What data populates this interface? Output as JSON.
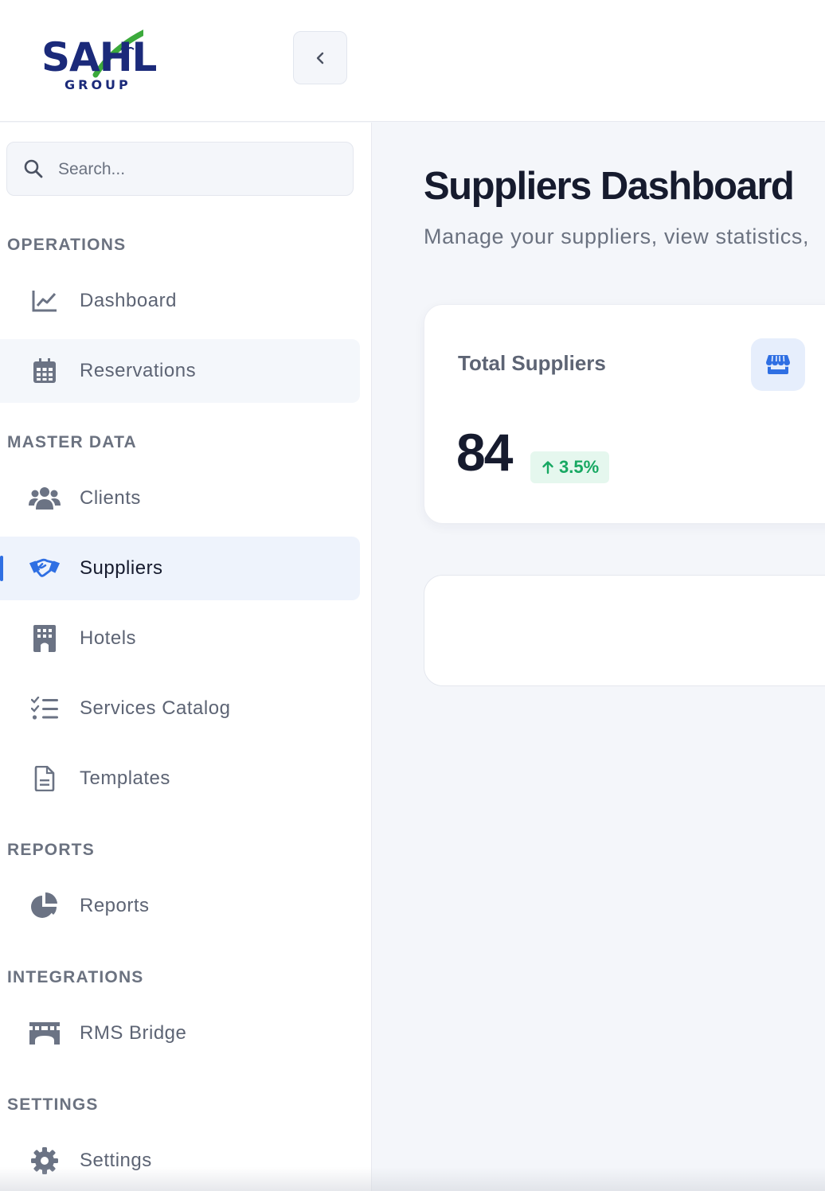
{
  "brand": {
    "logo_main": "SAHL",
    "logo_sub": "GROUP",
    "logo_navy": "#1b2a7a",
    "logo_green": "#3caa3c"
  },
  "header": {
    "collapse_icon": "chevron-left-icon"
  },
  "search": {
    "placeholder": "Search..."
  },
  "sidebar": {
    "sections": [
      {
        "label": "OPERATIONS"
      },
      {
        "label": "MASTER DATA"
      },
      {
        "label": "REPORTS"
      },
      {
        "label": "INTEGRATIONS"
      },
      {
        "label": "SETTINGS"
      }
    ],
    "items": [
      {
        "label": "Dashboard",
        "icon": "chart-line-icon"
      },
      {
        "label": "Reservations",
        "icon": "calendar-icon"
      },
      {
        "label": "Clients",
        "icon": "users-icon"
      },
      {
        "label": "Suppliers",
        "icon": "handshake-icon",
        "active": true
      },
      {
        "label": "Hotels",
        "icon": "building-icon"
      },
      {
        "label": "Services Catalog",
        "icon": "list-check-icon"
      },
      {
        "label": "Templates",
        "icon": "document-icon"
      },
      {
        "label": "Reports",
        "icon": "pie-chart-icon"
      },
      {
        "label": "RMS Bridge",
        "icon": "bridge-icon"
      },
      {
        "label": "Settings",
        "icon": "gear-icon"
      }
    ]
  },
  "main": {
    "title": "Suppliers Dashboard",
    "subtitle": "Manage your suppliers, view statistics,",
    "stat_card": {
      "title": "Total Suppliers",
      "icon": "store-icon",
      "value": "84",
      "change": "3.5%",
      "change_direction": "up"
    }
  },
  "colors": {
    "accent": "#2f6fe3",
    "active_bg": "#eef3fc",
    "positive": "#17a862",
    "positive_bg": "#e5f7ee",
    "muted_text": "#6b7280",
    "icon_gray": "#6b7384"
  }
}
